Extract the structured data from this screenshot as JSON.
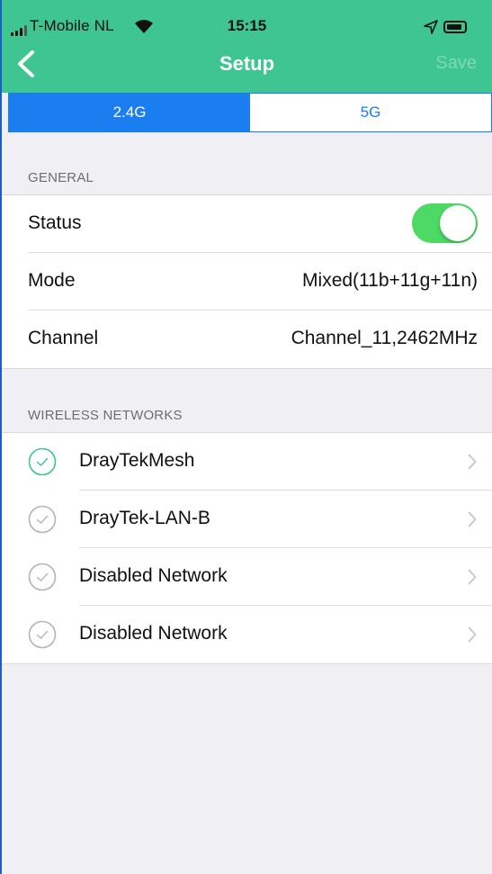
{
  "status_bar": {
    "carrier": "T-Mobile NL",
    "time": "15:15"
  },
  "nav": {
    "title": "Setup",
    "save_label": "Save"
  },
  "tabs": [
    {
      "label": "2.4G",
      "active": true
    },
    {
      "label": "5G",
      "active": false
    }
  ],
  "general": {
    "section_label": "GENERAL",
    "status_label": "Status",
    "status_on": true,
    "mode_label": "Mode",
    "mode_value": "Mixed(11b+11g+11n)",
    "channel_label": "Channel",
    "channel_value": "Channel_11,2462MHz"
  },
  "wireless": {
    "section_label": "WIRELESS NETWORKS",
    "networks": [
      {
        "name": "DrayTekMesh",
        "enabled": true
      },
      {
        "name": "DrayTek-LAN-B",
        "enabled": false
      },
      {
        "name": "Disabled Network",
        "enabled": false
      },
      {
        "name": "Disabled Network",
        "enabled": false
      }
    ]
  },
  "colors": {
    "header": "#3ec592",
    "accent_blue": "#1a7ef0",
    "toggle_on": "#4cd964",
    "check_active": "#3ec592",
    "check_inactive": "#b5b5b9"
  },
  "icons": {
    "back": "chevron-left-icon",
    "wifi": "wifi-icon",
    "location": "location-arrow-icon",
    "battery": "battery-icon",
    "check": "check-circle-icon",
    "disclosure": "chevron-right-icon"
  }
}
